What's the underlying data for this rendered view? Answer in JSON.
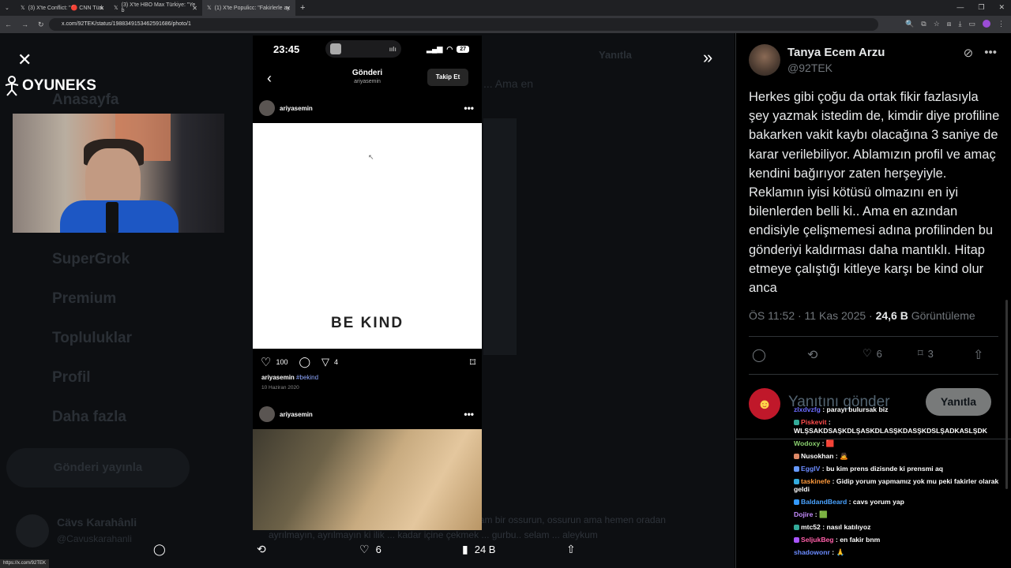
{
  "browser": {
    "tabs": [
      {
        "label": "(3) X'te Conflict: \"🔴 CNN Türk",
        "active": false
      },
      {
        "label": "(3) X'te HBO Max Türkiye: \"Ye b",
        "active": false
      },
      {
        "label": "(1) X'te Populicc: \"Fakirlerle ay",
        "active": true
      }
    ],
    "new_tab": "+",
    "url": "x.com/92TEK/status/1988349153462591686/photo/1",
    "status_url": "https://x.com/92TEK"
  },
  "overlay": {
    "logo_text": "OYUNEKS",
    "bg_menu": [
      "Anasayfa",
      "SuperGrok",
      "Premium",
      "Topluluklar",
      "Profil",
      "Daha fazla"
    ],
    "bg_post_button": "Gönderi yayınla",
    "bg_user": "Cävs Karahânli",
    "bg_user_handle": "@Cavuskarahanli",
    "bg_reply_label": "Yanıtla",
    "bg_text_top": "... Ama en",
    "bg_text_bottom": "Edilirseniz şu hanım kızımıze, bunun yanında sağlam bir ossurun, ossurun ama hemen oradan ayrılmayın, ayrılmayın ki ilik ... kadar içine çekmek ... gurbu.. selam ... aleykum"
  },
  "phone": {
    "time": "23:45",
    "battery": "27",
    "header_title": "Gönderi",
    "header_sub": "ariyasemin",
    "follow": "Takip Et",
    "post_user": "ariyasemin",
    "image_text": "BE KIND",
    "likes": "100",
    "shares": "4",
    "caption_user": "ariyasemin",
    "caption_tag": "#bekind",
    "date": "10 Haziran 2020",
    "post2_user": "ariyasemin"
  },
  "viewer_bar": {
    "likes": "6",
    "views": "24 B"
  },
  "tweet": {
    "name": "Tanya Ecem Arzu",
    "handle": "@92TEK",
    "text": "Herkes gibi çoğu da ortak fikir fazlasıyla şey yazmak istedim de, kimdir diye profiline bakarken vakit kaybı olacağına 3 saniye de karar verilebiliyor. Ablamızın profil ve amaç kendini bağırıyor zaten herşeyiyle. Reklamın iyisi kötüsü olmazını en iyi bilenlerden belli ki.. Ama en azından endisiyle çelişmemesi adına profilinden bu gönderiyi kaldırması daha mantıklı. Hitap etmeye çalıştığı kitleye karşı be kind olur anca",
    "time": "ÖS 11:52 · 11 Kas 2025 · ",
    "views": "24,6 B",
    "views_label": " Görüntüleme",
    "likes": "6",
    "bookmarks": "3",
    "reply_placeholder": "Yanıtını gönder",
    "reply_button": "Yanıtla"
  },
  "chat": [
    {
      "user": "zlxdvzfg",
      "color": "#6b6bff",
      "text": "parayı bulursak biz",
      "badge": ""
    },
    {
      "user": "Piskevit",
      "color": "#ff4d4d",
      "text": "WLŞSAKDSAŞKDLŞASKDLASŞKDASŞKDSLŞADKASLŞDK",
      "badge": "#3a9"
    },
    {
      "user": "Wodoxy",
      "color": "#8ad06e",
      "text": "🟥",
      "badge": ""
    },
    {
      "user": "Nusokhan",
      "color": "#ffffff",
      "text": "🙇",
      "badge": "#d86"
    },
    {
      "user": "EggIV",
      "color": "#6b8bff",
      "text": "bu kim prens dizisnde ki prensmi aq",
      "badge": "#69f"
    },
    {
      "user": "taskinefe",
      "color": "#ff9a3c",
      "text": "Gidip yorum yapmamız yok mu peki fakirler olarak geldi",
      "badge": "#3ad"
    },
    {
      "user": "BaldandBeard",
      "color": "#4aa3ff",
      "text": "cavs yorum yap",
      "badge": "#39f"
    },
    {
      "user": "Dojire",
      "color": "#c58cff",
      "text": "🟩",
      "badge": ""
    },
    {
      "user": "mtc52",
      "color": "#ffffff",
      "text": "nasıl katılıyoz",
      "badge": "#3a9"
    },
    {
      "user": "SeljukBeg",
      "color": "#ff5fa8",
      "text": "en fakir bnm",
      "badge": "#a5f"
    },
    {
      "user": "shadowonr",
      "color": "#6b8bff",
      "text": "🙏",
      "badge": ""
    }
  ]
}
